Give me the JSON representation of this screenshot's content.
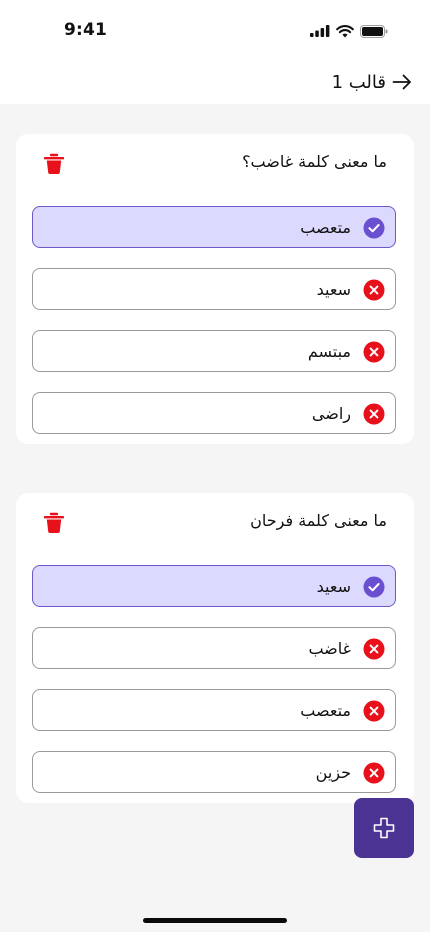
{
  "status_bar": {
    "time": "9:41"
  },
  "header": {
    "title": "قالب 1"
  },
  "questions": [
    {
      "text": "ما معنى كلمة غاضب؟",
      "options": [
        {
          "label": "متعصب",
          "correct": true
        },
        {
          "label": "سعيد",
          "correct": false
        },
        {
          "label": "مبتسم",
          "correct": false
        },
        {
          "label": "راضى",
          "correct": false
        }
      ]
    },
    {
      "text": "ما معنى كلمة فرحان",
      "options": [
        {
          "label": "سعيد",
          "correct": true
        },
        {
          "label": "غاضب",
          "correct": false
        },
        {
          "label": "متعصب",
          "correct": false
        },
        {
          "label": "حزين",
          "correct": false
        }
      ]
    }
  ],
  "icons": {
    "delete": "trash-icon",
    "correct": "check-circle-icon",
    "wrong": "x-circle-icon",
    "add": "plus-icon",
    "back": "arrow-right-icon"
  },
  "colors": {
    "accent": "#4a3392",
    "correct_bg": "#dcd9ff",
    "correct_border": "#6f58c9",
    "check_circle": "#6a4fd1",
    "wrong_circle": "#e8101b",
    "delete": "#e8101b"
  }
}
